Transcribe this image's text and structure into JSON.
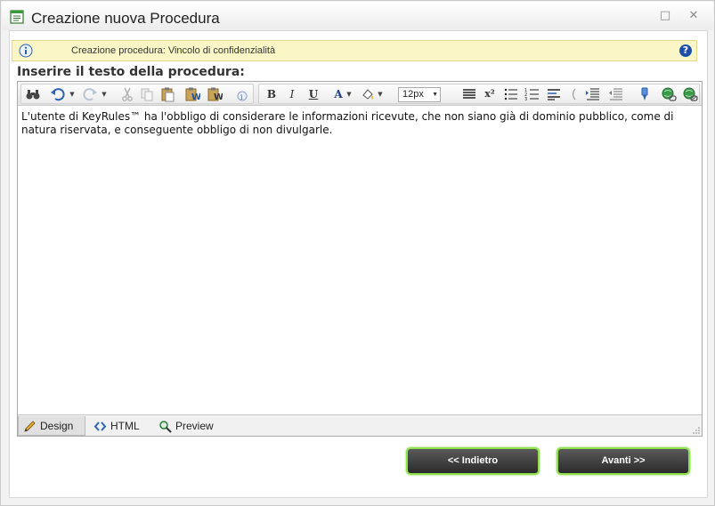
{
  "window": {
    "title": "Creazione nuova Procedura",
    "maximize_glyph": "□",
    "close_glyph": "✕"
  },
  "info_bar": {
    "text": "Creazione procedura: Vincolo di confidenzialità",
    "help_glyph": "?"
  },
  "section": {
    "label": "Inserire il testo della procedura:"
  },
  "editor": {
    "toolbar": {
      "bold_glyph": "B",
      "italic_glyph": "I",
      "underline_glyph": "U",
      "superscript_glyph": "x²",
      "font_color_glyph": "A",
      "font_size_value": "12px",
      "icons": [
        "find-icon",
        "undo-icon",
        "redo-icon",
        "cut-icon",
        "copy-icon",
        "paste-icon",
        "paste-from-word-icon",
        "paste-plain-text-icon",
        "spellcheck-icon",
        "bold-icon",
        "italic-icon",
        "underline-icon",
        "font-color-icon",
        "highlight-icon",
        "font-size-select",
        "justify-icon",
        "superscript-icon",
        "bullet-list-icon",
        "numbered-list-icon",
        "align-left-icon",
        "outdent-icon",
        "indent-icon",
        "style-icon",
        "insert-link-icon",
        "remove-link-icon"
      ]
    },
    "content": "L'utente di KeyRules™ ha l'obbligo di considerare le informazioni ricevute, che non siano già di dominio pubblico, come di natura riservata, e conseguente obbligo di non divulgarle.",
    "modes": {
      "design": "Design",
      "html": "HTML",
      "preview": "Preview",
      "active": "Design"
    }
  },
  "buttons": {
    "back": "<< Indietro",
    "next": "Avanti >>"
  },
  "colors": {
    "info_bg": "#fbf6c6",
    "button_border": "#8ee04c",
    "button_bg": "#3a3a3a"
  }
}
